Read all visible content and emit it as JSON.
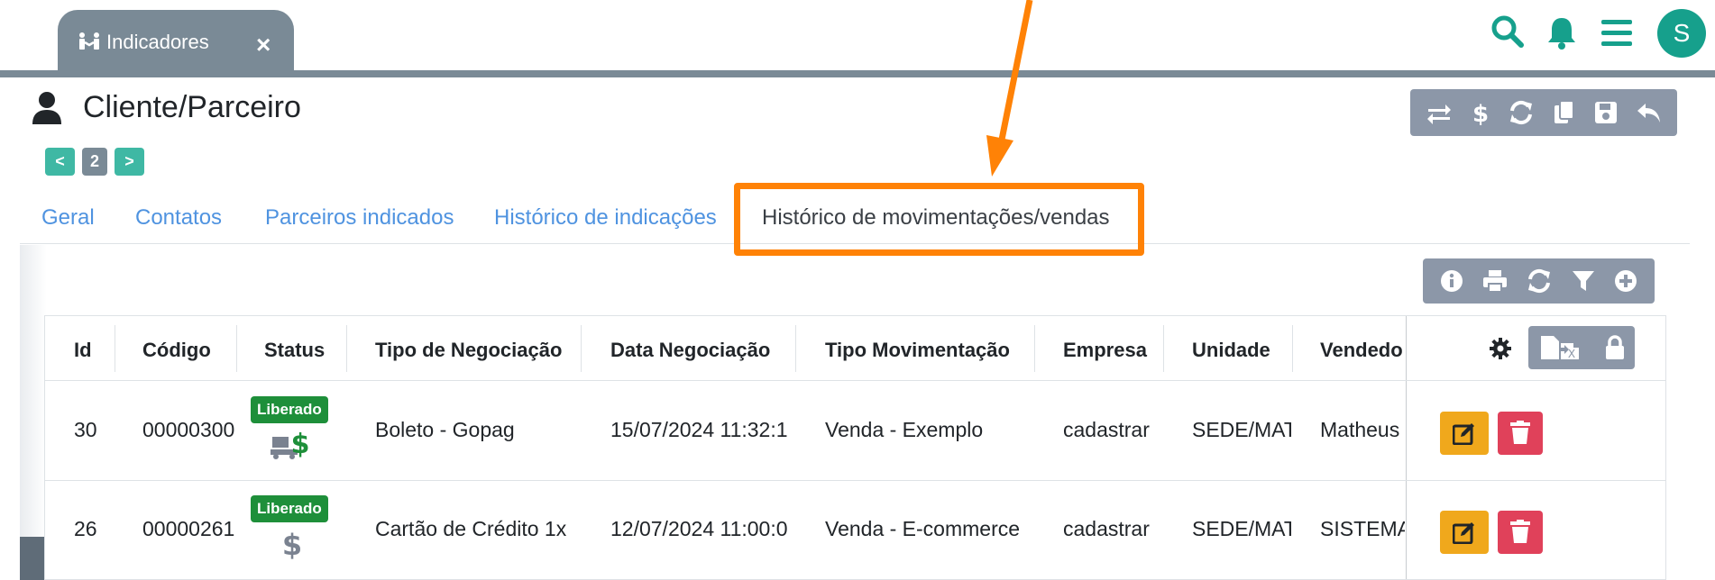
{
  "window": {
    "tab_label": "Indicadores",
    "tab_close": "×",
    "avatar_initial": "S"
  },
  "page": {
    "title": "Cliente/Parceiro",
    "pager": {
      "prev": "<",
      "current": "2",
      "next": ">"
    }
  },
  "tabs": [
    {
      "label": "Geral",
      "active": false
    },
    {
      "label": "Contatos",
      "active": false
    },
    {
      "label": "Parceiros indicados",
      "active": false
    },
    {
      "label": "Histórico de indicações",
      "active": false
    },
    {
      "label": "Histórico de movimentações/vendas",
      "active": true
    }
  ],
  "table": {
    "columns": [
      "Id",
      "Código",
      "Status",
      "Tipo de Negociação",
      "Data Negociação",
      "Tipo Movimentação",
      "Empresa",
      "Unidade",
      "Vendedo"
    ],
    "rows": [
      {
        "id": "30",
        "codigo": "00000300",
        "status": "Liberado",
        "tipo_negociacao": "Boleto - Gopag",
        "data": "15/07/2024 11:32:1",
        "tipo_mov": "Venda - Exemplo",
        "empresa": "cadastrar",
        "unidade": "SEDE/MAT",
        "vendedor": "Matheus"
      },
      {
        "id": "26",
        "codigo": "00000261",
        "status": "Liberado",
        "tipo_negociacao": "Cartão de Crédito 1x",
        "data": "12/07/2024 11:00:0",
        "tipo_mov": "Venda - E-commerce",
        "empresa": "cadastrar",
        "unidade": "SEDE/MAT",
        "vendedor": "SISTEMA"
      }
    ]
  },
  "colors": {
    "accent": "#16a08c",
    "tab_gray": "#7a8a96",
    "toolbar_gray": "#8c97a8",
    "link_blue": "#4f93e0",
    "highlight_orange": "#ff8206",
    "badge_green": "#1e8f3a",
    "edit_yellow": "#f0a81c",
    "delete_red": "#e0415a"
  },
  "icons": {
    "tab": "handshake-icon",
    "header": [
      "search-icon",
      "bell-icon",
      "menu-icon"
    ],
    "toolbar": [
      "swap-icon",
      "dollar-icon",
      "refresh-icon",
      "copy-icon",
      "save-icon",
      "undo-icon"
    ],
    "table_toolbar": [
      "info-icon",
      "print-icon",
      "refresh-icon",
      "filter-icon",
      "add-icon"
    ],
    "row_status": [
      "delivery-dollar-icon",
      "dollar-icon"
    ],
    "row_actions": [
      "edit-icon",
      "delete-icon"
    ]
  }
}
